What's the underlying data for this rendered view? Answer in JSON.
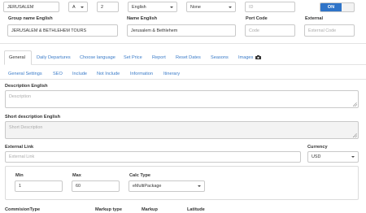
{
  "top_row": {
    "city_value": "JERUSALEM",
    "letter_value": "A",
    "number_value": "2",
    "language_value": "English",
    "none_value": "None",
    "id_placeholder": "ID",
    "toggle_label": "ON"
  },
  "fields": {
    "group_name_label": "Group name English",
    "group_name_value": "JERUSALEM & BETHLEHEM TOURS",
    "name_label": "Name English",
    "name_value": "Jerusalem & Bethlehem",
    "port_code_label": "Port Code",
    "port_code_placeholder": "Code",
    "external_label": "External",
    "external_placeholder": "External Code"
  },
  "tabs": [
    "General",
    "Daily Departures",
    "Choose language",
    "Set Price",
    "Report",
    "Reset Dates",
    "Seasons",
    "Images"
  ],
  "subtabs": [
    "General Settings",
    "SEO",
    "Include",
    "Not Include",
    "Information",
    "Itinerary"
  ],
  "description": {
    "label": "Description English",
    "placeholder": "Description"
  },
  "short_description": {
    "label": "Short description English",
    "placeholder": "Short Description"
  },
  "external_link": {
    "label": "External Link",
    "placeholder": "External Link"
  },
  "currency": {
    "label": "Currency",
    "value": "USD"
  },
  "pricing": {
    "min_label": "Min",
    "min_value": "1",
    "max_label": "Max",
    "max_value": "60",
    "calc_label": "Calc Type",
    "calc_value": "eMultiPackage"
  },
  "bottom_labels": [
    "CommisionType",
    "Markup type",
    "Markup",
    "Latitude"
  ],
  "colors": {
    "accent": "#2f74c8",
    "link": "#3a7bc8"
  },
  "icons": {
    "images_tab": "camera-icon"
  }
}
